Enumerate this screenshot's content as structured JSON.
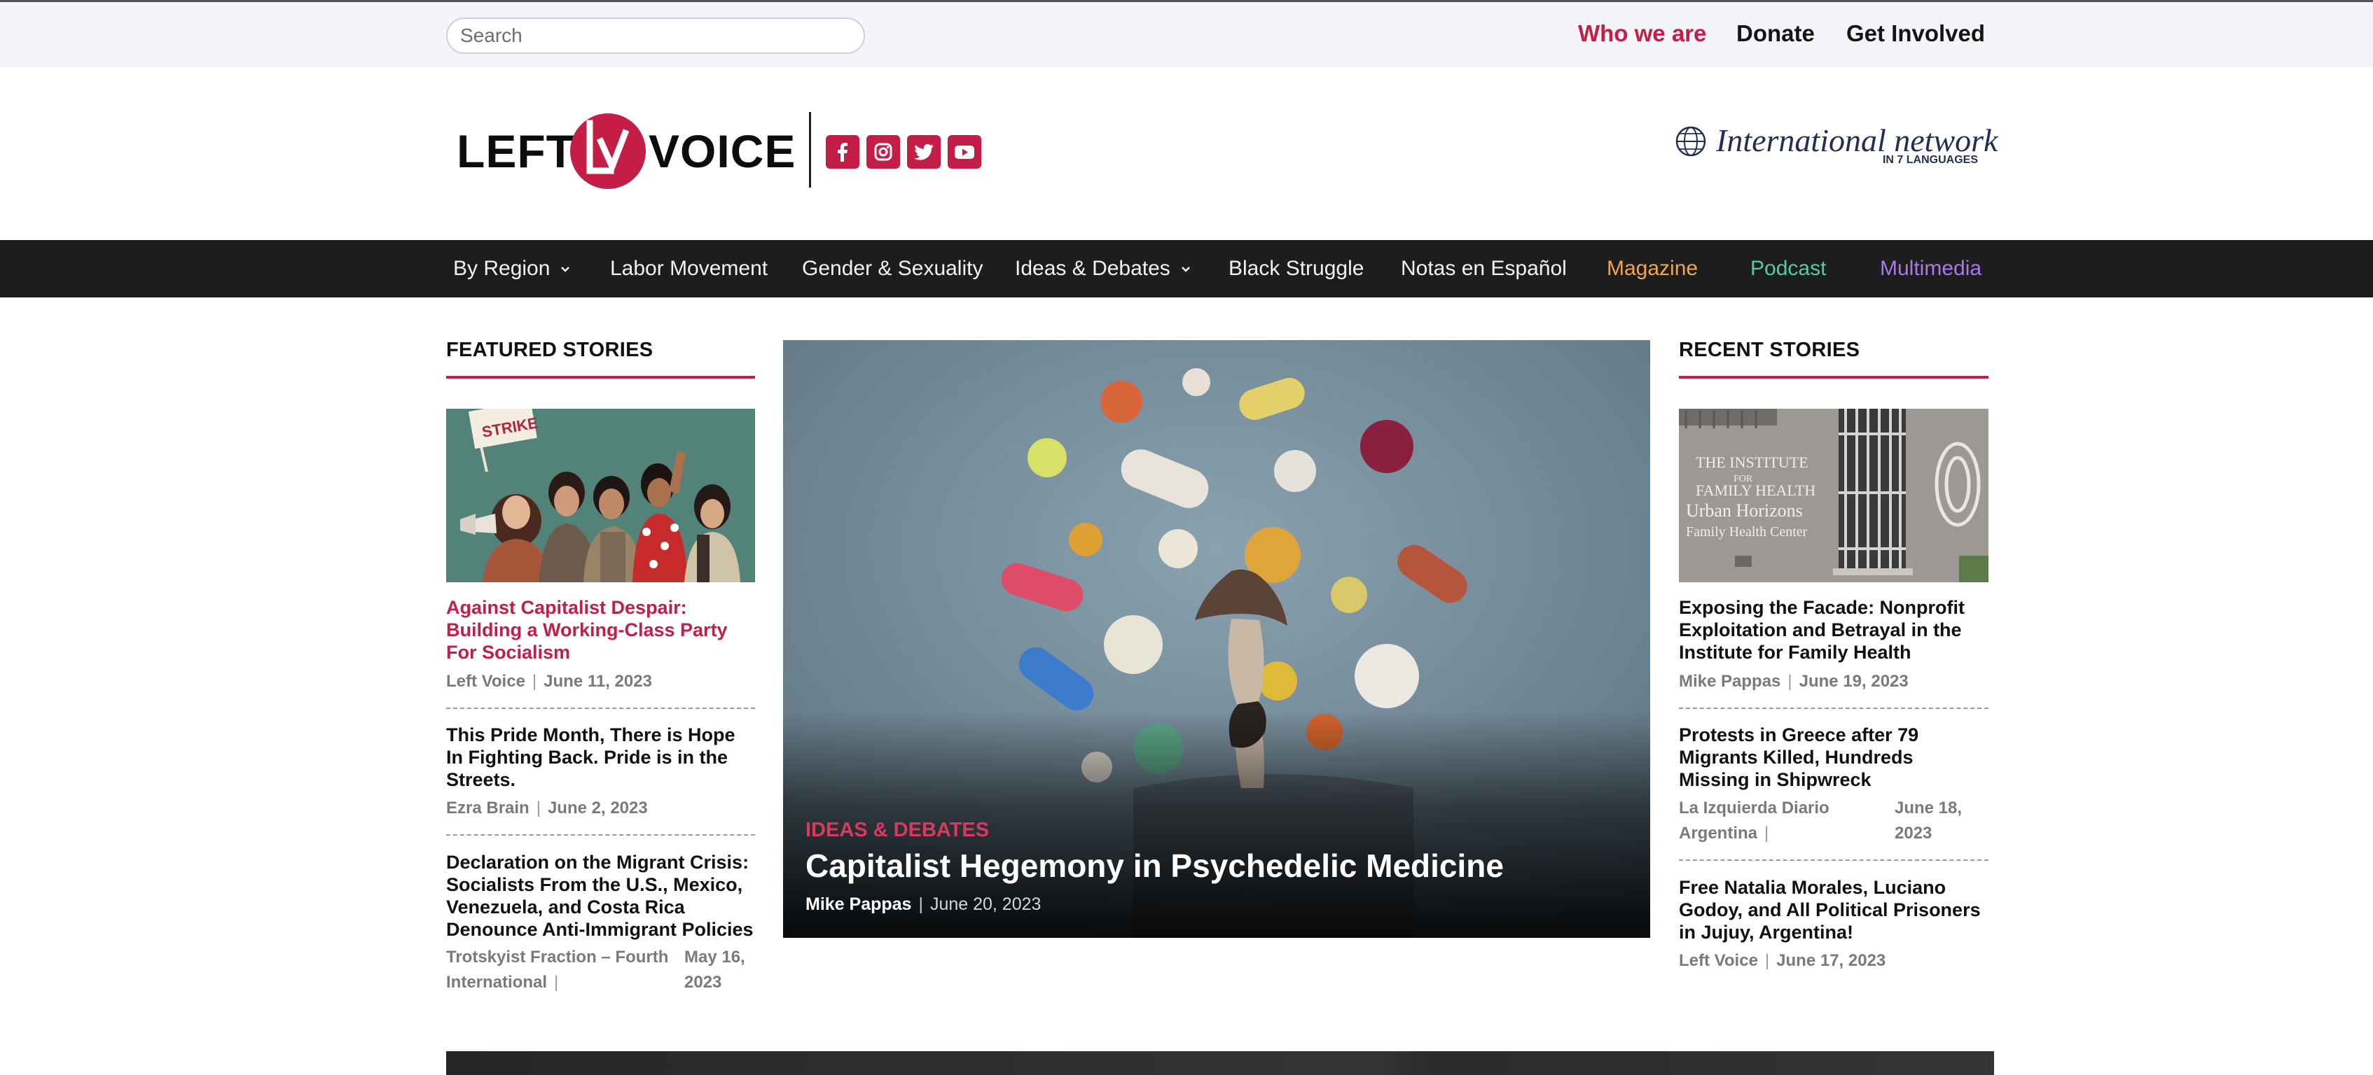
{
  "topbar": {
    "search_placeholder": "Search",
    "links": [
      "Who we are",
      "Donate",
      "Get Involved"
    ]
  },
  "header": {
    "logo_left": "LEFT",
    "logo_mark": "LV",
    "logo_right": "VOICE",
    "social_icons": [
      "facebook-icon",
      "instagram-icon",
      "twitter-icon",
      "youtube-icon"
    ],
    "international_title": "International network",
    "international_sub": "IN 7 LANGUAGES"
  },
  "nav": {
    "items": [
      "By Region",
      "Labor Movement",
      "Gender & Sexuality",
      "Ideas & Debates",
      "Black Struggle",
      "Notas en Español",
      "Magazine",
      "Podcast",
      "Multimedia"
    ]
  },
  "colors": {
    "accent": "#c41e47",
    "magazine": "#f2a54a",
    "podcast": "#56c9a8",
    "multimedia": "#a97ae6",
    "nav_bg": "#1d1d1d"
  },
  "featured": {
    "heading": "FEATURED STORIES",
    "stories": [
      {
        "title": "Against Capitalist Despair: Building a Working-Class Party For Socialism",
        "author": "Left Voice",
        "date": "June 11, 2023"
      },
      {
        "title": "This Pride Month, There is Hope In Fighting Back. Pride is in the Streets.",
        "author": "Ezra Brain",
        "date": "June 2, 2023"
      },
      {
        "title": "Declaration on the Migrant Crisis: Socialists From the U.S., Mexico, Venezuela, and Costa Rica Denounce Anti-Immigrant Policies",
        "author": "Trotskyist Fraction – Fourth International",
        "date": "May 16, 2023"
      }
    ],
    "image_sign": "STRIKE"
  },
  "hero": {
    "category": "IDEAS & DEBATES",
    "title": "Capitalist Hegemony in Psychedelic Medicine",
    "author": "Mike Pappas",
    "date": "June 20, 2023"
  },
  "recent": {
    "heading": "RECENT STORIES",
    "stories": [
      {
        "title": "Exposing the Facade: Nonprofit Exploitation and Betrayal in the Institute for Family Health",
        "author": "Mike Pappas",
        "date": "June 19, 2023"
      },
      {
        "title": "Protests in Greece after 79 Migrants Killed, Hundreds Missing in Shipwreck",
        "author": "La Izquierda Diario Argentina",
        "date": "June 18, 2023"
      },
      {
        "title": "Free Natalia Morales, Luciano Godoy, and All Political Prisoners in Jujuy, Argentina!",
        "author": "Left Voice",
        "date": "June 17, 2023"
      }
    ],
    "image_sign_lines": [
      "THE INSTITUTE",
      "FOR",
      "FAMILY HEALTH",
      "Urban Horizons",
      "Family Health Center"
    ]
  }
}
